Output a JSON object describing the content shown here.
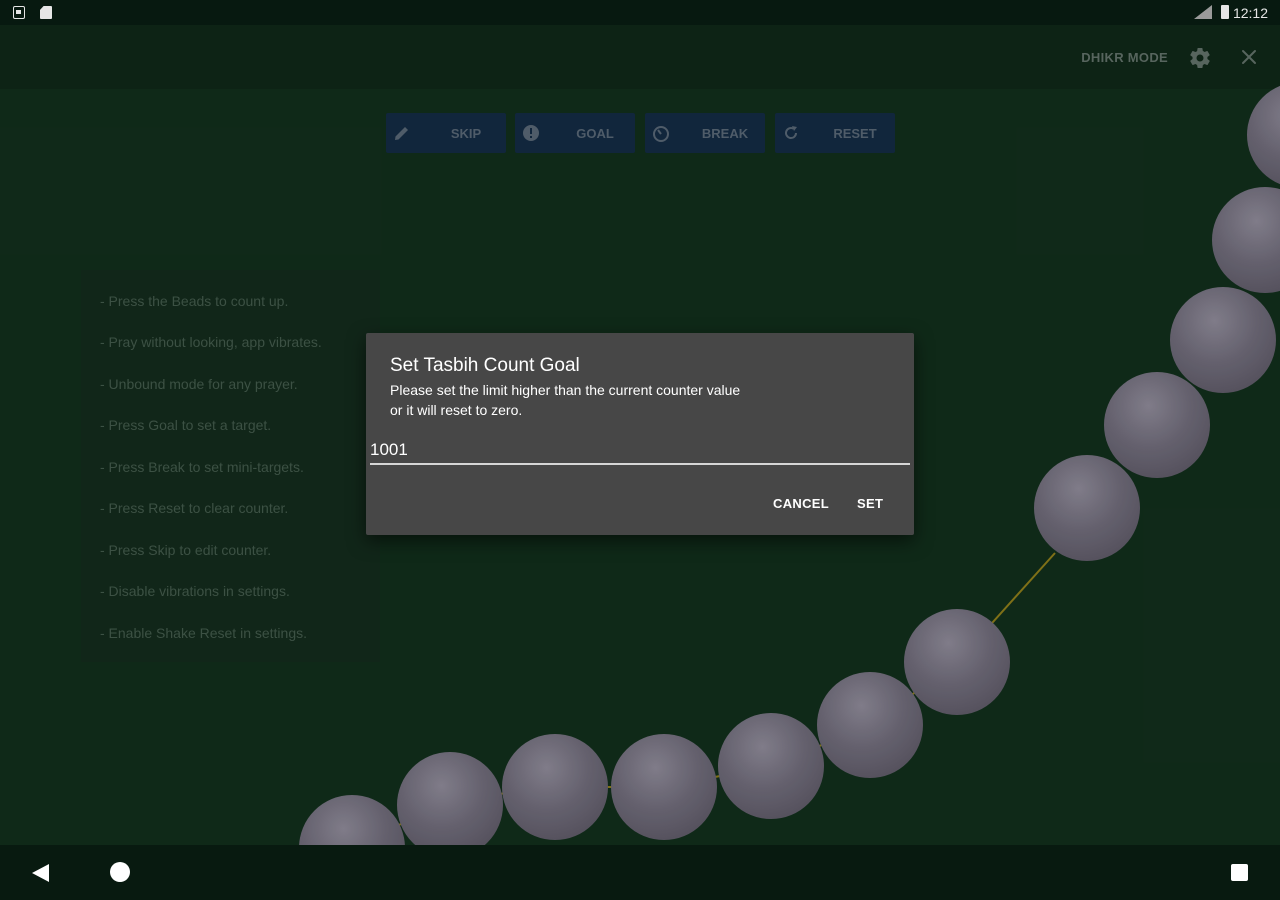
{
  "status_bar": {
    "time": "12:12"
  },
  "app_bar": {
    "mode_label": "DHIKR MODE"
  },
  "toolbar": [
    {
      "label": "SKIP",
      "icon": "pencil-icon"
    },
    {
      "label": "GOAL",
      "icon": "goal-icon"
    },
    {
      "label": "BREAK",
      "icon": "timer-icon"
    },
    {
      "label": "RESET",
      "icon": "refresh-icon"
    }
  ],
  "tips": [
    "- Press the Beads to count up.",
    "- Pray without looking, app vibrates.",
    "- Unbound mode for any prayer.",
    "- Press Goal to set a target.",
    "- Press Break to set mini-targets.",
    "- Press Reset to clear counter.",
    "- Press Skip to edit counter.",
    "- Disable vibrations in settings.",
    "- Enable Shake Reset in settings."
  ],
  "dialog": {
    "title": "Set Tasbih Count Goal",
    "message_line1": "Please set the limit higher than the current counter value",
    "message_line2": "or it will reset to zero.",
    "input_value": "1001",
    "cancel_label": "CANCEL",
    "set_label": "SET"
  },
  "colors": {
    "background": "#112d1b",
    "toolbar_button": "#132a42",
    "dialog": "#474747",
    "bead": "#6e6a78",
    "string": "#8a7a1a"
  }
}
